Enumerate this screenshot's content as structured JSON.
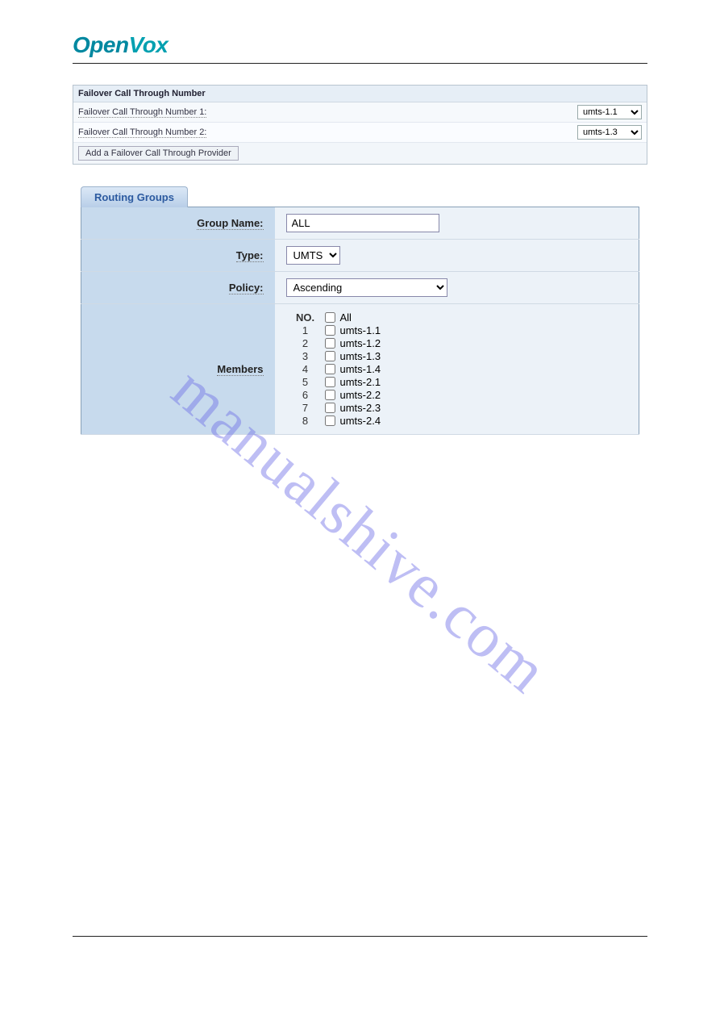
{
  "logo": {
    "part1": "Open",
    "part2": "Vox"
  },
  "failover": {
    "header": "Failover Call Through Number",
    "rows": [
      {
        "label": "Failover Call Through Number 1:",
        "value": "umts-1.1"
      },
      {
        "label": "Failover Call Through Number 2:",
        "value": "umts-1.3"
      }
    ],
    "button": "Add a Failover Call Through Provider"
  },
  "routing": {
    "tab": "Routing Groups",
    "group_name_label": "Group Name:",
    "group_name_value": "ALL",
    "type_label": "Type:",
    "type_value": "UMTS",
    "policy_label": "Policy:",
    "policy_value": "Ascending",
    "members_label": "Members",
    "members_header": "NO.",
    "members": [
      {
        "no": "",
        "label": "All"
      },
      {
        "no": "1",
        "label": "umts-1.1"
      },
      {
        "no": "2",
        "label": "umts-1.2"
      },
      {
        "no": "3",
        "label": "umts-1.3"
      },
      {
        "no": "4",
        "label": "umts-1.4"
      },
      {
        "no": "5",
        "label": "umts-2.1"
      },
      {
        "no": "6",
        "label": "umts-2.2"
      },
      {
        "no": "7",
        "label": "umts-2.3"
      },
      {
        "no": "8",
        "label": "umts-2.4"
      }
    ]
  },
  "watermark": "manualshive.com"
}
